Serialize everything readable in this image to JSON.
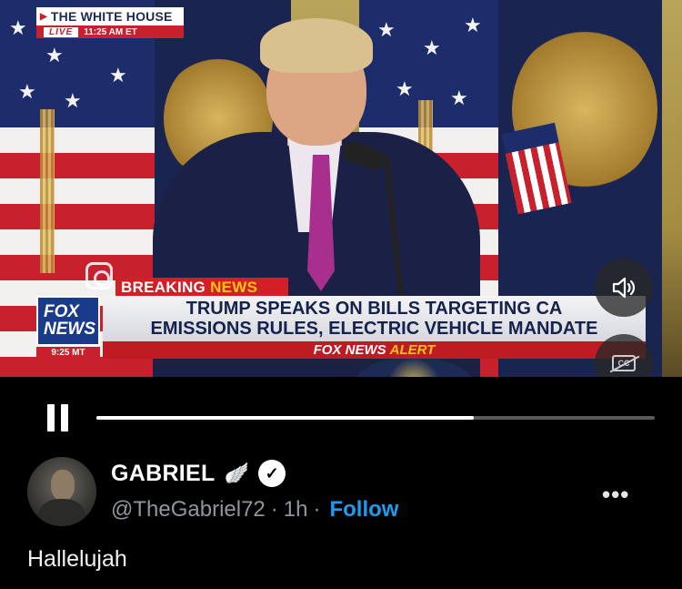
{
  "network_bug": {
    "channel": "THE WHITE HOUSE",
    "live": "LIVE",
    "time": "11:25 AM ET"
  },
  "lower_third": {
    "breaking": "BREAKING",
    "news": "NEWS",
    "headline_line1": "TRUMP SPEAKS ON BILLS TARGETING CA",
    "headline_line2": "EMISSIONS RULES, ELECTRIC VEHICLE MANDATE",
    "alert_brand": "FOX NEWS",
    "alert_word": "ALERT",
    "logo_line1": "FOX",
    "logo_line2": "NEWS",
    "logo_time": "9:25 MT"
  },
  "player": {
    "progress": 0.676,
    "cc_label": "CC"
  },
  "tweet": {
    "display_name": "GABRIEL",
    "wing_emoji": "🪽",
    "verified_mark": "✓",
    "handle": "@TheGabriel72",
    "separator": "·",
    "age": "1h",
    "follow_label": "Follow",
    "more_label": "•••",
    "text": "Hallelujah"
  },
  "colors": {
    "follow_blue": "#1d9bf0",
    "fox_red": "#d31f26",
    "fox_navy": "#14224d"
  }
}
